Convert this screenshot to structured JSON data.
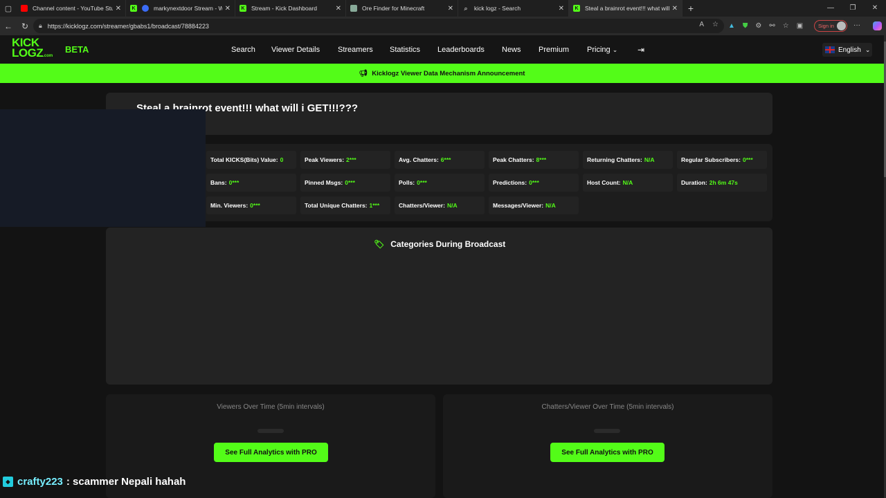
{
  "browser": {
    "tabs": [
      {
        "title": "Channel content - YouTube Studio",
        "icon": "youtube-icon",
        "color": "#ff0000"
      },
      {
        "title": "markynextdoor Stream - Watch",
        "icon": "globe-icon",
        "color": "#3b6cf6"
      },
      {
        "title": "Stream - Kick Dashboard",
        "icon": "kick-icon",
        "color": "#53fc18"
      },
      {
        "title": "Ore Finder for Minecraft",
        "icon": "ore-icon",
        "color": "#888888"
      },
      {
        "title": "kick logz - Search",
        "icon": "search-icon",
        "color": "#888888"
      },
      {
        "title": "Steal a brainrot event!!! what will i GET!!!???",
        "icon": "kicklogz-icon",
        "color": "#53fc18",
        "active": true
      }
    ],
    "url": "https://kicklogz.com/streamer/gbabs1/broadcast/78884223",
    "signin_label": "Sign in"
  },
  "site": {
    "logo_line1": "KICK",
    "logo_line2": "LOGZ",
    "logo_suffix": ".com",
    "beta": "BETA",
    "nav": [
      "Search",
      "Viewer Details",
      "Streamers",
      "Statistics",
      "Leaderboards",
      "News",
      "Premium",
      "Pricing"
    ],
    "language": "English",
    "announcement": "Kicklogz Viewer Data Mechanism Announcement",
    "accent": "#53fc18"
  },
  "broadcast": {
    "title": "Steal a brainrot event!!! what will i GET!!!???",
    "stats": [
      {
        "label": "Total KICKS(Bits) Value:",
        "value": "0"
      },
      {
        "label": "Peak Viewers:",
        "value": "2***"
      },
      {
        "label": "Avg. Chatters:",
        "value": "6***"
      },
      {
        "label": "Peak Chatters:",
        "value": "8***"
      },
      {
        "label": "Returning Chatters:",
        "value": "N/A"
      },
      {
        "label": "Regular Subscribers:",
        "value": "0***"
      },
      {
        "label": "Bans:",
        "value": "0***"
      },
      {
        "label": "Pinned Msgs:",
        "value": "0***"
      },
      {
        "label": "Polls:",
        "value": "0***"
      },
      {
        "label": "Predictions:",
        "value": "0***"
      },
      {
        "label": "Host Count:",
        "value": "N/A"
      },
      {
        "label": "Duration:",
        "value": "2h 6m 47s"
      },
      {
        "label": "Min. Viewers:",
        "value": "0***"
      },
      {
        "label": "Total Unique Chatters:",
        "value": "1***"
      },
      {
        "label": "Chatters/Viewer:",
        "value": "N/A"
      },
      {
        "label": "Messages/Viewer:",
        "value": "N/A"
      }
    ],
    "categories_title": "Categories During Broadcast",
    "charts": [
      {
        "title": "Viewers Over Time (5min intervals)",
        "button": "See Full Analytics with PRO"
      },
      {
        "title": "Chatters/Viewer Over Time (5min intervals)",
        "button": "See Full Analytics with PRO"
      }
    ]
  },
  "chat_overlay": {
    "user": "crafty223",
    "message": ": scammer Nepali hahah"
  }
}
